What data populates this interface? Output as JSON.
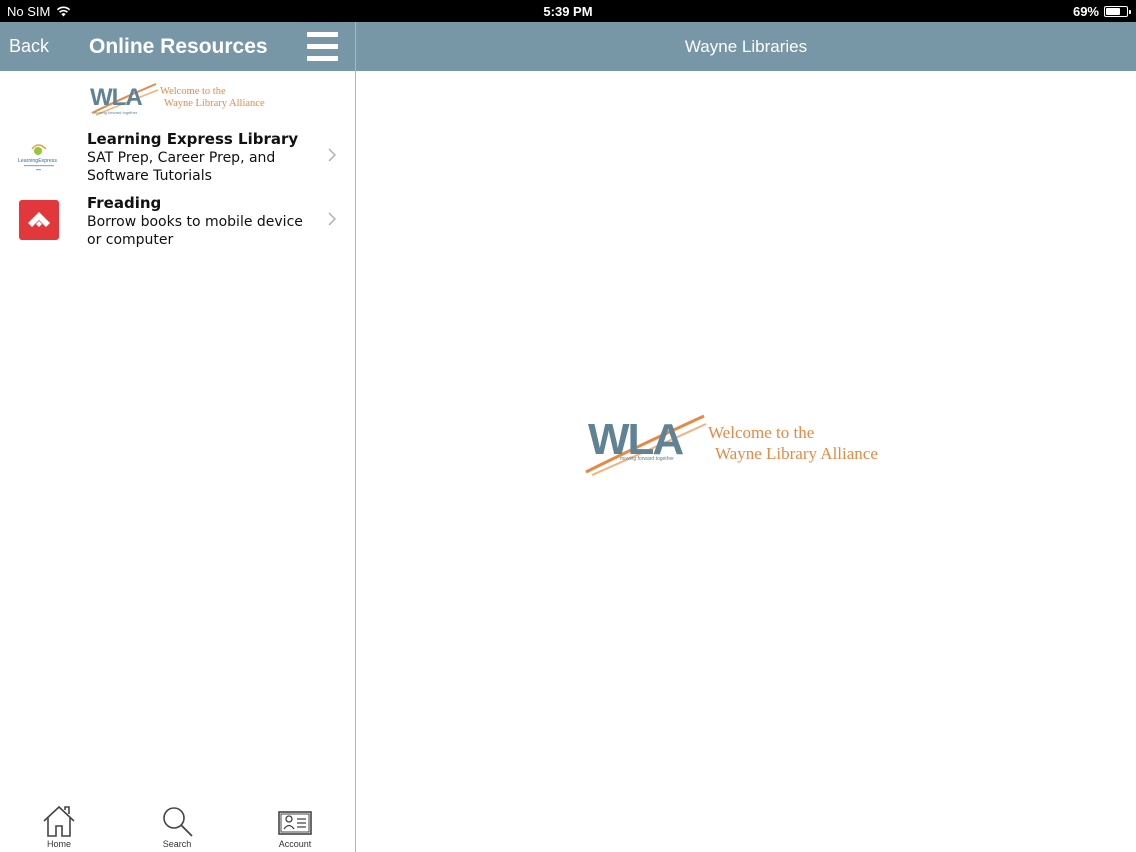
{
  "status_bar": {
    "carrier": "No SIM",
    "time": "5:39 PM",
    "battery_percent": "69%",
    "battery_level": 0.69
  },
  "left_nav": {
    "back_label": "Back",
    "title": "Online Resources",
    "menu_icon": "hamburger-menu-icon"
  },
  "banner": {
    "logo_letters": "WLA",
    "tagline": "moving forward together",
    "welcome_line1": "Welcome to the",
    "welcome_line2": "Wayne Library Alliance"
  },
  "resources": [
    {
      "title": "Learning Express Library",
      "description": "SAT Prep, Career Prep, and Software Tutorials",
      "icon": "learning-express-logo",
      "logo_text": "LearningExpress"
    },
    {
      "title": "Freading",
      "description": "Borrow books to mobile device or computer",
      "icon": "freading-icon"
    }
  ],
  "tabbar": {
    "items": [
      {
        "label": "Home",
        "icon": "home-icon"
      },
      {
        "label": "Search",
        "icon": "search-icon"
      },
      {
        "label": "Account",
        "icon": "account-card-icon"
      }
    ]
  },
  "right_nav": {
    "title": "Wayne Libraries"
  },
  "colors": {
    "nav_bar": "#7797a7",
    "logo_orange": "#e58a45",
    "logo_slate": "#5f8294",
    "freading_red": "#e2373b"
  }
}
